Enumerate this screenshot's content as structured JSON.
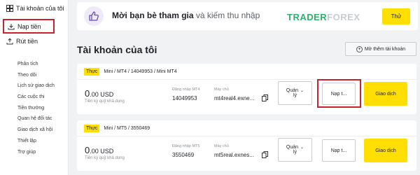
{
  "sidebar": {
    "top_label": "Tài khoản của tôi",
    "deposit_label": "Nạp tiền",
    "withdraw_label": "Rút tiền",
    "items": [
      {
        "label": "Phân tích"
      },
      {
        "label": "Theo dõi"
      },
      {
        "label": "Lịch sử giao dịch"
      },
      {
        "label": "Các cuộc thi"
      },
      {
        "label": "Tiền thưởng"
      },
      {
        "label": "Quan hệ đối tác"
      },
      {
        "label": "Giao dịch xã hội"
      },
      {
        "label": "Thiết lập"
      },
      {
        "label": "Trợ giúp"
      }
    ]
  },
  "banner": {
    "text_bold": "Mời bạn bè tham gia",
    "text_rest": " và kiếm thu nhập",
    "logo_part1": "TRADER",
    "logo_part2": "FOREX",
    "button_label": "Thử"
  },
  "header": {
    "title": "Tài khoản của tôi",
    "open_account_label": "Mở thêm tài khoản"
  },
  "accounts": [
    {
      "badge": "Thực",
      "name": "Mini / MT4 / 14049953 / Mini MT4",
      "balance_main": "0",
      "balance_rest": ".00 USD",
      "balance_sub": "Tiền ký quỹ khả dụng",
      "login_label": "Đăng nhập MT4",
      "login": "14049953",
      "server_label": "Máy chủ",
      "server": "mt4real4.exne...",
      "manage_line1": "Quản",
      "manage_line2": "lý",
      "deposit_label": "Nạp t...",
      "trade_label": "Giao dịch"
    },
    {
      "badge": "Thực",
      "name": "Mini / MT5 / 3550469",
      "balance_main": "0",
      "balance_rest": ".00 USD",
      "balance_sub": "Tiền ký quỹ khả dụng",
      "login_label": "Đăng nhập MT5",
      "login": "3550469",
      "server_label": "Máy chủ",
      "server": "mt5real.exnes...",
      "manage_line1": "Quản",
      "manage_line2": "lý",
      "deposit_label": "Nạp t...",
      "trade_label": "Giao dịch"
    }
  ],
  "colors": {
    "accent_yellow": "#ffde02",
    "highlight_red": "#c8232c",
    "background": "#f1f2f4"
  }
}
